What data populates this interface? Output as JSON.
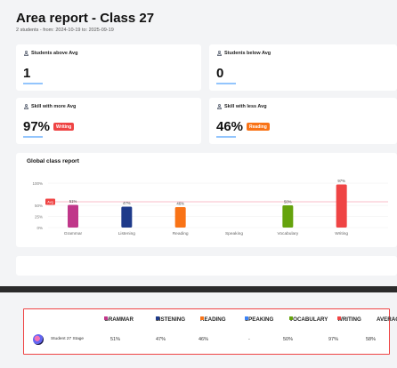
{
  "header": {
    "title": "Area report - Class 27",
    "subtitle": "2 students - from: 2024-10-19 to: 2025-09-19"
  },
  "cards": {
    "above": {
      "label": "Students above Avg",
      "value": "1"
    },
    "below": {
      "label": "Students below Avg",
      "value": "0"
    },
    "more": {
      "label": "Skill with more Avg",
      "value": "97%",
      "badge": "Writing",
      "badge_color": "#ef4444"
    },
    "less": {
      "label": "Skill with less Avg",
      "value": "46%",
      "badge": "Reading",
      "badge_color": "#f97316"
    }
  },
  "chart": {
    "title": "Global class report",
    "avg_label": "Avg"
  },
  "chart_data": {
    "type": "bar",
    "title": "Global class report",
    "categories": [
      "Grammar",
      "Listening",
      "Reading",
      "Speaking",
      "Vocabulary",
      "Writing"
    ],
    "values": [
      51,
      47,
      46,
      null,
      50,
      97
    ],
    "data_labels": [
      "51%",
      "47%",
      "46%",
      "",
      "50%",
      "97%"
    ],
    "colors": [
      "#c0378a",
      "#1e3a8a",
      "#f97316",
      "#3b82f6",
      "#65a30d",
      "#ef4444"
    ],
    "yticks": [
      "100%",
      "50%",
      "25%",
      "0%"
    ],
    "ylim": [
      0,
      100
    ],
    "average_line": 58,
    "average_color": "#f7a8b8"
  },
  "table": {
    "headers": [
      {
        "label": "GRAMMAR",
        "color": "#c0378a"
      },
      {
        "label": "LISTENING",
        "color": "#1e3a8a"
      },
      {
        "label": "READING",
        "color": "#f97316"
      },
      {
        "label": "SPEAKING",
        "color": "#3b82f6"
      },
      {
        "label": "VOCABULARY",
        "color": "#65a30d"
      },
      {
        "label": "WRITING",
        "color": "#ef4444"
      },
      {
        "label": "AVERAGE",
        "color": ""
      }
    ],
    "rows": [
      {
        "name": "Student 27 Stage",
        "values": [
          "51%",
          "47%",
          "46%",
          "-",
          "50%",
          "97%",
          "58%"
        ]
      }
    ]
  }
}
